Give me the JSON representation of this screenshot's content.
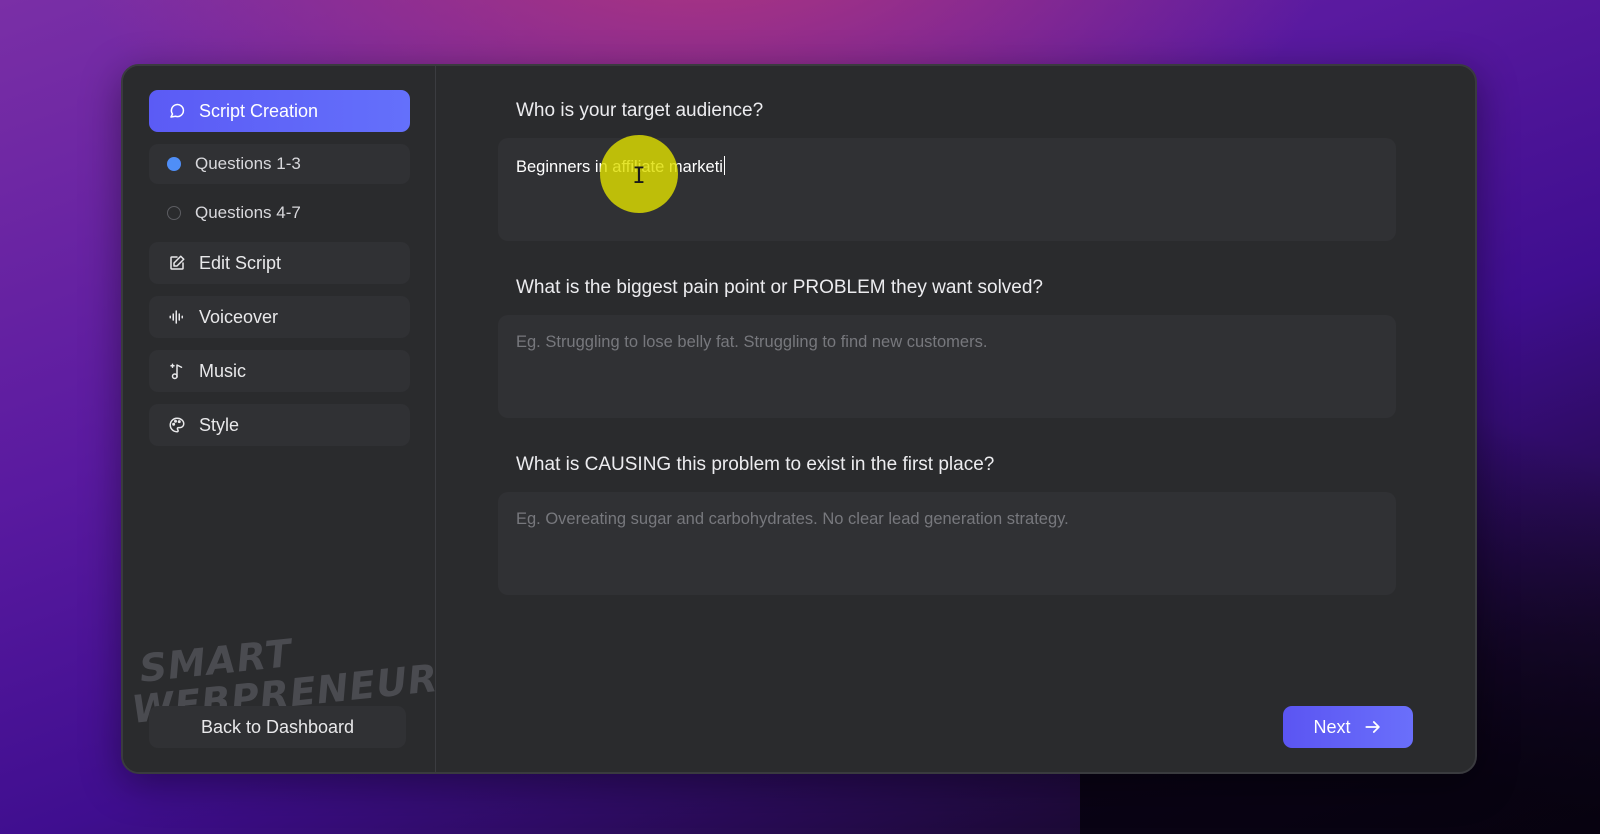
{
  "sidebar": {
    "items": [
      {
        "label": "Script Creation",
        "icon": "chat-bubble-icon",
        "active": true
      },
      {
        "label": "Edit Script",
        "icon": "edit-icon"
      },
      {
        "label": "Voiceover",
        "icon": "audio-wave-icon"
      },
      {
        "label": "Music",
        "icon": "music-note-icon"
      },
      {
        "label": "Style",
        "icon": "palette-icon"
      }
    ],
    "sub_items": [
      {
        "label": "Questions 1-3",
        "status": "current"
      },
      {
        "label": "Questions 4-7",
        "status": "pending"
      }
    ],
    "logo": {
      "line1": "SMART",
      "line2": "WEBPRENEUR"
    },
    "back_label": "Back to Dashboard"
  },
  "questions": [
    {
      "label": "Who is your target audience?",
      "value": "Beginners in affiliate marketi",
      "placeholder": ""
    },
    {
      "label": "What is the biggest pain point or PROBLEM they want solved?",
      "value": "",
      "placeholder": "Eg. Struggling to lose belly fat. Struggling to find new customers."
    },
    {
      "label": "What is CAUSING this problem to exist in the first place?",
      "value": "",
      "placeholder": "Eg. Overeating sugar and carbohydrates. No clear lead generation strategy."
    }
  ],
  "next_label": "Next",
  "colors": {
    "accent": "#5b5bf5",
    "panel": "#2a2b2d",
    "field": "#303134",
    "dot_active": "#4f8ef7",
    "highlight": "#dede00"
  }
}
